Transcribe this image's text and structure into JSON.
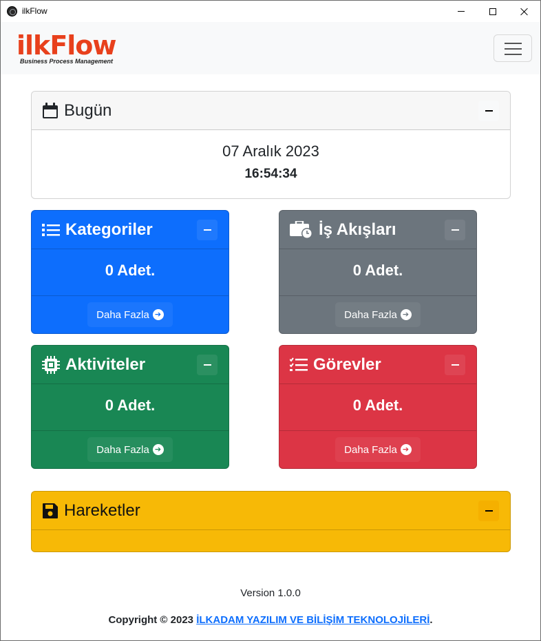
{
  "window": {
    "title": "ilkFlow"
  },
  "navbar": {
    "logo_text": "ilkFlow",
    "logo_subtitle": "Business Process Management",
    "toggler_icon": "hamburger-icon"
  },
  "today": {
    "title": "Bugün",
    "icon": "calendar-icon",
    "date": "07 Aralık 2023",
    "time": "16:54:34"
  },
  "stats": [
    {
      "key": "categories",
      "title": "Kategoriler",
      "icon": "list-icon",
      "count": "0 Adet.",
      "more_label": "Daha Fazla",
      "color": "#0d6efd"
    },
    {
      "key": "workflows",
      "title": "İş Akışları",
      "icon": "briefcase-clock-icon",
      "count": "0 Adet.",
      "more_label": "Daha Fazla",
      "color": "#6c757d"
    },
    {
      "key": "activities",
      "title": "Aktiviteler",
      "icon": "cpu-icon",
      "count": "0 Adet.",
      "more_label": "Daha Fazla",
      "color": "#198754"
    },
    {
      "key": "tasks",
      "title": "Görevler",
      "icon": "checklist-icon",
      "count": "0 Adet.",
      "more_label": "Daha Fazla",
      "color": "#dc3545"
    }
  ],
  "moves": {
    "title": "Hareketler",
    "icon": "floppy-disk-icon",
    "color": "#f7b906"
  },
  "footer": {
    "version": "Version 1.0.0",
    "copyright_prefix": "Copyright © 2023",
    "company_link": "İLKADAM YAZILIM VE BİLİŞİM TEKNOLOJİLERİ",
    "copyright_suffix": "."
  }
}
